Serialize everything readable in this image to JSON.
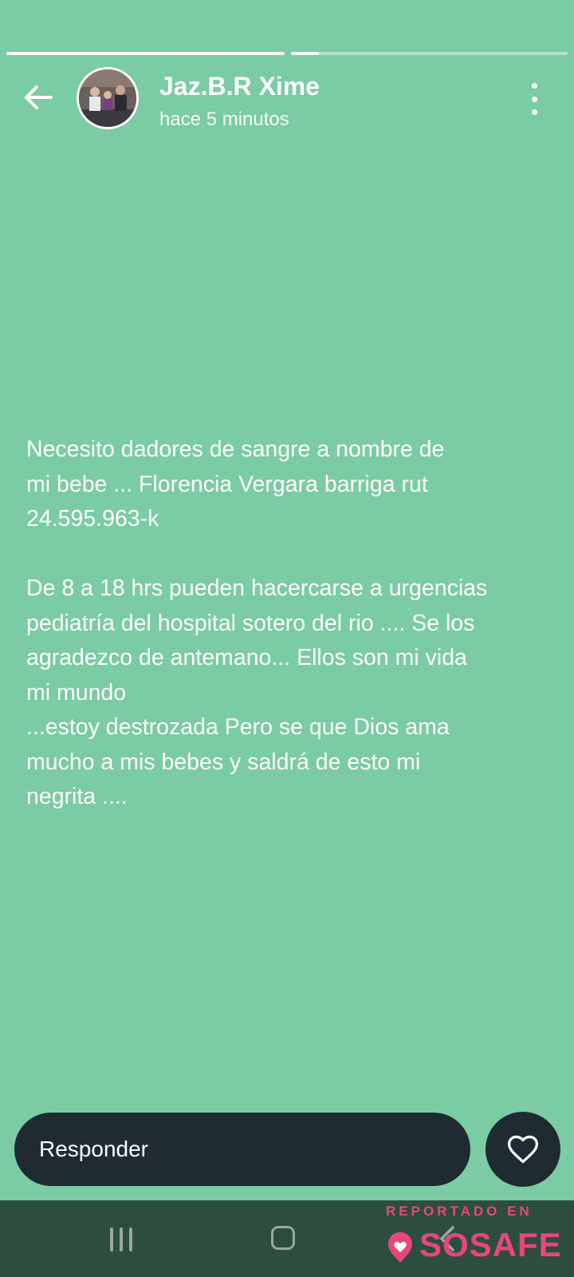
{
  "story": {
    "progress": [
      1.0,
      0.1
    ],
    "username": "Jaz.B.R Xime",
    "time": "hace 5 minutos",
    "text": "Necesito dadores de sangre a nombre de\nmi bebe ... Florencia Vergara barriga rut\n24.595.963-k\n\nDe 8 a 18 hrs pueden hacercarse a urgencias\npediatría del hospital sotero del rio .... Se los\nagradezco de antemano... Ellos son mi vida\nmi mundo\n...estoy destrozada Pero se que Dios ama\nmucho a mis bebes y saldrá de esto mi\nnegrita ...."
  },
  "reply": {
    "label": "Responder"
  },
  "icons": {
    "back": "arrow-left-icon",
    "menu": "more-vert-icon",
    "like": "heart-outline-icon",
    "recents": "recents-icon",
    "home": "home-icon",
    "nav_back": "nav-back-icon"
  },
  "watermark": {
    "top": "REPORTADO EN",
    "brand": "SOSAFE"
  },
  "colors": {
    "background": "#7bcba5",
    "reply_bg": "#1f2b31",
    "nav_bg": "#2d4d3f",
    "watermark": "#e8477e"
  }
}
